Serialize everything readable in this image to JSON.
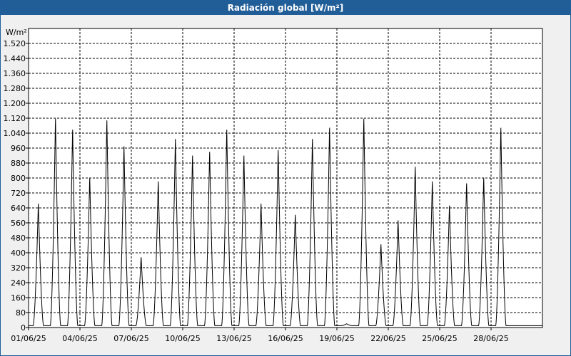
{
  "window": {
    "title": "Radiación global [W/m²]"
  },
  "chart_data": {
    "type": "line",
    "title": "Radiación global [W/m²]",
    "ylabel": "W/m²",
    "xlabel": "",
    "ylim": [
      0,
      1600
    ],
    "xlim": [
      0,
      30
    ],
    "grid": true,
    "y_ticks": [
      0,
      80,
      160,
      240,
      320,
      400,
      480,
      560,
      640,
      720,
      800,
      880,
      960,
      1040,
      1120,
      1200,
      1280,
      1360,
      1440,
      1520
    ],
    "y_tick_labels": [
      "0",
      "80",
      "160",
      "240",
      "320",
      "400",
      "480",
      "560",
      "640",
      "720",
      "800",
      "880",
      "960",
      "1.040",
      "1.120",
      "1.200",
      "1.280",
      "1.360",
      "1.440",
      "1.520"
    ],
    "x_ticks": [
      0,
      3,
      6,
      9,
      12,
      15,
      18,
      21,
      24,
      27
    ],
    "x_tick_labels": [
      "01/06/25",
      "04/06/25",
      "07/06/25",
      "10/06/25",
      "13/06/25",
      "16/06/25",
      "19/06/25",
      "22/06/25",
      "25/06/25",
      "28/06/25"
    ],
    "series": [
      {
        "color": "#000000",
        "daily_peak_hour": 13.7,
        "daily_peaks": [
          670,
          1130,
          1070,
          810,
          1120,
          980,
          380,
          790,
          1020,
          930,
          950,
          1070,
          930,
          670,
          960,
          610,
          1020,
          1080,
          20,
          1130,
          450,
          580,
          870,
          790,
          660,
          780,
          810,
          1080,
          0,
          0
        ]
      }
    ]
  }
}
